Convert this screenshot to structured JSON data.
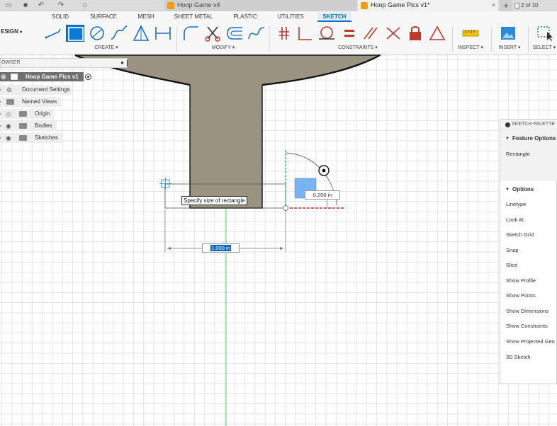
{
  "titlebar": {
    "tabs": [
      {
        "label": "Hoop Game v4",
        "active": false
      },
      {
        "label": "Hoop Game Pics v1*",
        "active": true
      }
    ],
    "close_glyph": "×",
    "new_tab_glyph": "+",
    "counter": "2 of 10"
  },
  "ribbon": {
    "workspace": "ESIGN",
    "tabs": [
      "SOLID",
      "SURFACE",
      "MESH",
      "SHEET METAL",
      "PLASTIC",
      "UTILITIES",
      "SKETCH"
    ],
    "active_tab": "SKETCH",
    "groups": {
      "create": "CREATE ▾",
      "modify": "MODIFY ▾",
      "constraints": "CONSTRAINTS ▾",
      "inspect": "INSPECT ▾",
      "insert": "INSERT ▾",
      "select": "SELECT ▾"
    },
    "tools": {
      "create": [
        "line-icon",
        "rectangle-icon",
        "circle-icon",
        "spline-icon",
        "triangle-icon",
        "dimension-icon"
      ],
      "modify": [
        "fillet-icon",
        "trim-icon",
        "offset-icon",
        "curve-icon"
      ],
      "constraints": [
        "coincident-icon",
        "perpendicular-icon",
        "tangent-icon",
        "equal-icon",
        "parallel-icon",
        "collinear-icon",
        "lock-icon",
        "triangle-constraint-icon"
      ],
      "inspect": [
        "measure-icon"
      ],
      "insert": [
        "image-icon"
      ],
      "select": [
        "select-icon"
      ]
    }
  },
  "browser": {
    "header": "OWSER",
    "collapse_glyph": "●",
    "root": "Hoop Game Pics v1",
    "items": [
      {
        "label": "Document Settings"
      },
      {
        "label": "Named Views"
      },
      {
        "label": "Origin"
      },
      {
        "label": "Bodies"
      },
      {
        "label": "Sketches"
      }
    ]
  },
  "canvas": {
    "tooltip": "Specify size of rectangle",
    "width_dimension": "1.000 in",
    "height_dimension": "0.200 in"
  },
  "palette": {
    "title": "SKETCH PALETTE",
    "feature_options": {
      "label": "Feature Options",
      "items": [
        "Rectangle"
      ]
    },
    "options": {
      "label": "Options",
      "items": [
        "Linetype",
        "Look At",
        "Sketch Grid",
        "Snap",
        "Slice",
        "Show Profile",
        "Show Points",
        "Show Dimensions",
        "Show Constraints",
        "Show Projected Geo",
        "3D Sketch"
      ]
    }
  },
  "colors": {
    "body_fill": "#9b9382",
    "accent_blue": "#0a7bd4",
    "axis_green": "#33c24a",
    "axis_red": "#e0202a"
  }
}
